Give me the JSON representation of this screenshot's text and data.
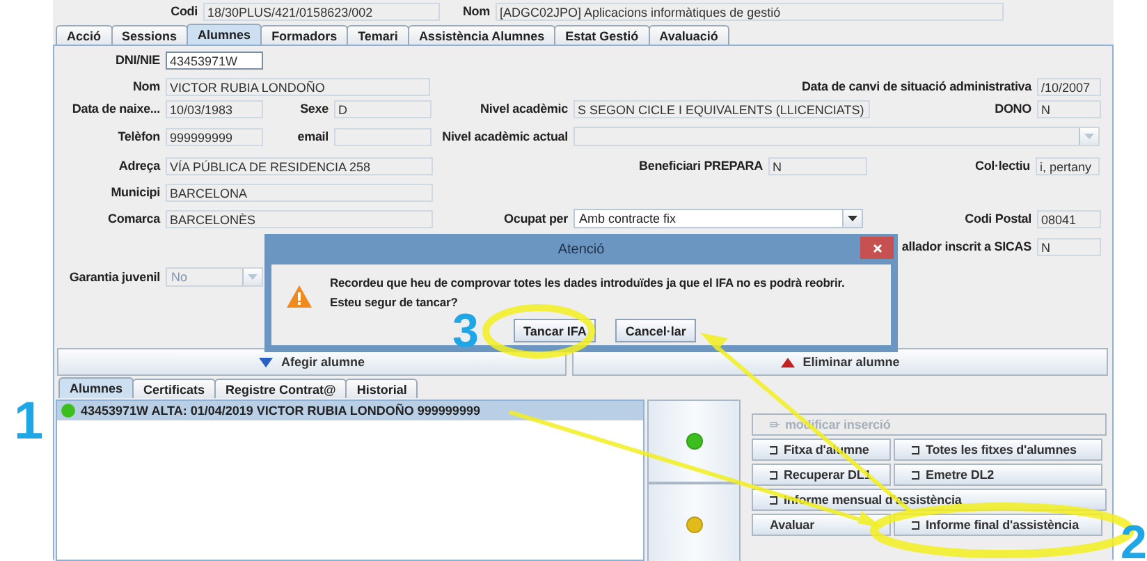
{
  "header": {
    "fields": [
      {
        "label": "Codi",
        "value": "18/30PLUS/421/0158623/002"
      },
      {
        "label": "Nom",
        "value": "[ADGC02JPO] Aplicacions informàtiques de gestió"
      }
    ]
  },
  "tabs": [
    {
      "label": "Acció",
      "selected": false
    },
    {
      "label": "Sessions",
      "selected": false
    },
    {
      "label": "Alumnes",
      "selected": true
    },
    {
      "label": "Formadors",
      "selected": false
    },
    {
      "label": "Temari",
      "selected": false
    },
    {
      "label": "Assistència Alumnes",
      "selected": false
    },
    {
      "label": "Estat Gestió",
      "selected": false
    },
    {
      "label": "Avaluació",
      "selected": false
    }
  ],
  "form": {
    "fields": [
      {
        "label": "DNI/NIE",
        "value": "43453971W",
        "kind": "input",
        "disabled": false
      },
      {
        "label": "Nom",
        "value": "VICTOR RUBIA LONDOÑO",
        "kind": "field",
        "disabled": false
      },
      {
        "label": "Data de canvi de situació administrativa",
        "value": "/10/2007",
        "kind": "field",
        "disabled": false
      },
      {
        "label": "Data de naixe...",
        "value": "10/03/1983",
        "kind": "field",
        "disabled": false
      },
      {
        "label": "Sexe",
        "value": "D",
        "kind": "field",
        "disabled": false
      },
      {
        "label": "Nivel acadèmic",
        "value": "S SEGON CICLE I EQUIVALENTS (LLICENCIATS)",
        "kind": "field",
        "disabled": false
      },
      {
        "label": "DONO",
        "value": "N",
        "kind": "field",
        "disabled": false
      },
      {
        "label": "Telèfon",
        "value": "999999999",
        "kind": "field",
        "disabled": false
      },
      {
        "label": "email",
        "kind": "field",
        "disabled": false
      },
      {
        "label": "Nivel acadèmic actual",
        "kind": "combo",
        "disabled": true
      },
      {
        "label": "Adreça",
        "value": "VÍA PÚBLICA DE RESIDENCIA 258",
        "kind": "field",
        "disabled": false
      },
      {
        "label": "Beneficiari PREPARA",
        "value": "N",
        "kind": "field",
        "disabled": false
      },
      {
        "label": "Col·lectiu",
        "value": "i, pertany",
        "kind": "field",
        "disabled": false
      },
      {
        "label": "Municipi",
        "value": "BARCELONA",
        "kind": "field",
        "disabled": false
      },
      {
        "label": "Comarca",
        "value": "BARCELONÈS",
        "kind": "field",
        "disabled": false
      },
      {
        "label": "Ocupat per",
        "value": "Amb contracte fix",
        "kind": "combo",
        "disabled": false
      },
      {
        "label": "Codi Postal",
        "value": "08041",
        "kind": "field",
        "disabled": false
      },
      {
        "label": "allador inscrit a SICAS",
        "value": "N",
        "kind": "field",
        "disabled": false
      },
      {
        "label": "Garantia juvenil",
        "value": "No",
        "kind": "combo",
        "disabled": true
      }
    ]
  },
  "actions": [
    {
      "label": "Afegir alumne",
      "kind": "add"
    },
    {
      "label": "Eliminar alumne",
      "kind": "remove"
    }
  ],
  "subtabs": [
    {
      "label": "Alumnes",
      "selected": true
    },
    {
      "label": "Certificats",
      "selected": false
    },
    {
      "label": "Registre Contrat@",
      "selected": false
    },
    {
      "label": "Historial",
      "selected": false
    }
  ],
  "list": {
    "rows": [
      {
        "text": "43453971W  ALTA: 01/04/2019 VICTOR RUBIA LONDOÑO 999999999",
        "selected": true,
        "color": "#3cbf1e"
      }
    ]
  },
  "status_buttons": [
    {
      "color": "#3cbf1e"
    },
    {
      "color": "#e0bb1a"
    }
  ],
  "panel_buttons": [
    [
      {
        "label": "modificar inserció",
        "kind": "edit",
        "disabled": true
      }
    ],
    [
      {
        "label": "Fitxa d'alumne",
        "kind": "report",
        "disabled": false
      },
      {
        "label": "Totes les fitxes d'alumnes",
        "kind": "report",
        "disabled": false
      }
    ],
    [
      {
        "label": "Recuperar DL1",
        "kind": "report",
        "disabled": false
      },
      {
        "label": "Emetre DL2",
        "kind": "report",
        "disabled": false
      }
    ],
    [
      {
        "label": "Informe mensual d'assistència",
        "kind": "report",
        "disabled": false
      }
    ],
    [
      {
        "label": "Avaluar",
        "kind": "plain",
        "disabled": false
      },
      {
        "label": "Informe final d'assistència",
        "kind": "report",
        "disabled": false
      }
    ]
  ],
  "dialog": {
    "title": "Atenció",
    "message": [
      "Recordeu que heu de comprovar totes les dades introduïdes ja que el IFA no es podrà reobrir.",
      "Esteu segur de tancar?"
    ],
    "buttons": [
      "Tancar IFA",
      "Cancel·lar"
    ]
  },
  "annotations": [
    {
      "label": "1"
    },
    {
      "label": "3"
    },
    {
      "label": "2"
    }
  ]
}
